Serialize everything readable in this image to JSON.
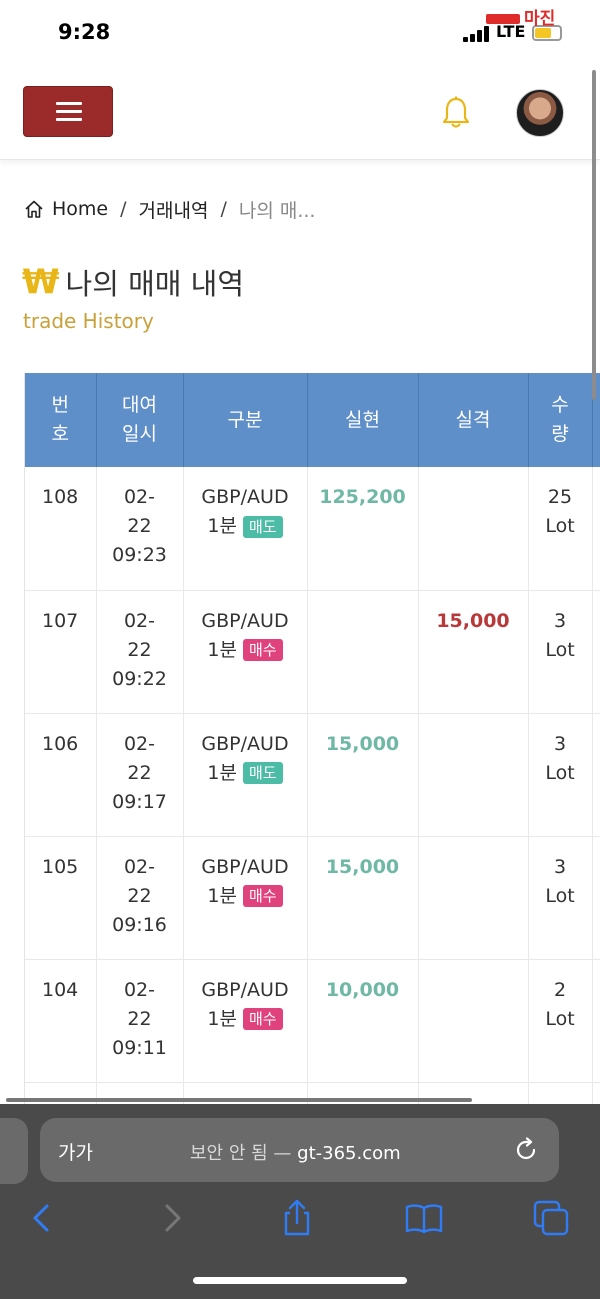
{
  "status_bar": {
    "time": "9:28",
    "network": "LTE",
    "watermark": "마진"
  },
  "header": {
    "menu_icon": "hamburger-icon",
    "bell_icon": "bell-icon",
    "avatar": "user-avatar"
  },
  "breadcrumb": {
    "home": "Home",
    "section": "거래내역",
    "current": "나의 매..."
  },
  "page": {
    "icon": "₩",
    "title": "나의 매매 내역",
    "subtitle": "trade History"
  },
  "table": {
    "headers": {
      "no": [
        "번",
        "호"
      ],
      "date": [
        "대여",
        "일시"
      ],
      "type": "구분",
      "profit": "실현",
      "loss": "실격",
      "qty": [
        "수",
        "량"
      ]
    },
    "rows": [
      {
        "no": "108",
        "date": [
          "02-",
          "22",
          "09:23"
        ],
        "pair": "GBP/AUD",
        "period": "1분",
        "side": "매도",
        "side_kind": "sell",
        "profit": "125,200",
        "loss": "",
        "qty": [
          "25",
          "Lot"
        ]
      },
      {
        "no": "107",
        "date": [
          "02-",
          "22",
          "09:22"
        ],
        "pair": "GBP/AUD",
        "period": "1분",
        "side": "매수",
        "side_kind": "buy",
        "profit": "",
        "loss": "15,000",
        "qty": [
          "3",
          "Lot"
        ]
      },
      {
        "no": "106",
        "date": [
          "02-",
          "22",
          "09:17"
        ],
        "pair": "GBP/AUD",
        "period": "1분",
        "side": "매도",
        "side_kind": "sell",
        "profit": "15,000",
        "loss": "",
        "qty": [
          "3",
          "Lot"
        ]
      },
      {
        "no": "105",
        "date": [
          "02-",
          "22",
          "09:16"
        ],
        "pair": "GBP/AUD",
        "period": "1분",
        "side": "매수",
        "side_kind": "buy",
        "profit": "15,000",
        "loss": "",
        "qty": [
          "3",
          "Lot"
        ]
      },
      {
        "no": "104",
        "date": [
          "02-",
          "22",
          "09:11"
        ],
        "pair": "GBP/AUD",
        "period": "1분",
        "side": "매수",
        "side_kind": "buy",
        "profit": "10,000",
        "loss": "",
        "qty": [
          "2",
          "Lot"
        ]
      }
    ]
  },
  "browser": {
    "aa": "가가",
    "security": "보안 안 됨 —",
    "domain": "gt-365.com"
  },
  "colors": {
    "header_blue": "#5e8fc9",
    "menu_red": "#9b2a2a",
    "profit": "#6fb8a6",
    "loss": "#b8393a",
    "sell_badge": "#4cbca6",
    "buy_badge": "#e0427d",
    "title_gold": "#c9a13a"
  }
}
